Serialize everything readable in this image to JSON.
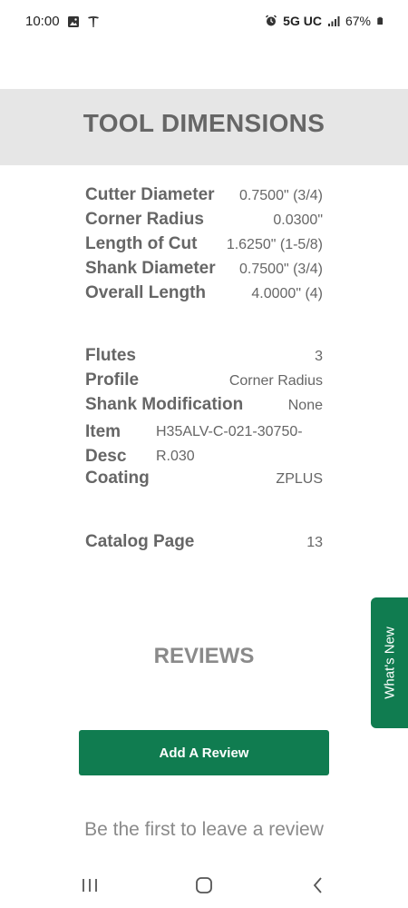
{
  "status_bar": {
    "time": "10:00",
    "network": "5G UC",
    "battery": "67%"
  },
  "header": {
    "title": "TOOL DIMENSIONS"
  },
  "dimensions": [
    {
      "label": "Cutter Diameter",
      "value": "0.7500\" (3/4)"
    },
    {
      "label": "Corner Radius",
      "value": "0.0300\""
    },
    {
      "label": "Length of Cut",
      "value": "1.6250\" (1-5/8)"
    },
    {
      "label": "Shank Diameter",
      "value": "0.7500\" (3/4)"
    },
    {
      "label": "Overall Length",
      "value": "4.0000\" (4)"
    }
  ],
  "attributes": {
    "flutes": {
      "label": "Flutes",
      "value": "3"
    },
    "profile": {
      "label": "Profile",
      "value": "Corner Radius"
    },
    "shank_mod": {
      "label": "Shank Modification",
      "value": "None"
    },
    "item_desc": {
      "label_line1": "Item",
      "label_line2": "Desc",
      "value_line1": "H35ALV-C-021-30750-",
      "value_line2": "R.030"
    },
    "coating": {
      "label": "Coating",
      "value": "ZPLUS"
    }
  },
  "catalog": {
    "label": "Catalog Page",
    "value": "13"
  },
  "reviews": {
    "title": "REVIEWS",
    "add_button": "Add A Review",
    "empty_message": "Be the first to leave a review"
  },
  "whats_new": {
    "label": "What's New"
  },
  "colors": {
    "accent": "#107c50",
    "header_band": "#e6e6e6",
    "text": "#666666"
  }
}
